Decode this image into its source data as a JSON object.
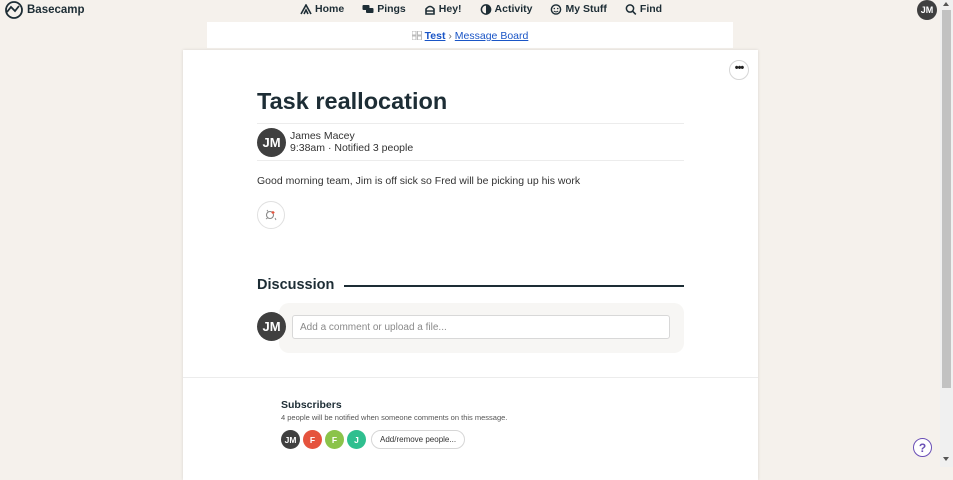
{
  "nav": {
    "brand": "Basecamp",
    "items": [
      {
        "label": "Home",
        "icon": "home-icon"
      },
      {
        "label": "Pings",
        "icon": "pings-icon"
      },
      {
        "label": "Hey!",
        "icon": "hey-icon"
      },
      {
        "label": "Activity",
        "icon": "activity-icon"
      },
      {
        "label": "My Stuff",
        "icon": "my-stuff-icon"
      },
      {
        "label": "Find",
        "icon": "search-icon"
      }
    ],
    "user_initials": "JM"
  },
  "breadcrumb": {
    "project": "Test",
    "separator": "›",
    "section": "Message Board"
  },
  "message": {
    "title": "Task reallocation",
    "author": "James Macey",
    "author_initials": "JM",
    "time": "9:38am",
    "meta_separator": "·",
    "notified": "Notified 3 people",
    "body": "Good morning team, Jim is off sick so Fred will be picking up his work",
    "more_label": "•••"
  },
  "discussion": {
    "title": "Discussion",
    "user_initials": "JM",
    "placeholder": "Add a comment or upload a file..."
  },
  "subscribers": {
    "title": "Subscribers",
    "note": "4 people will be notified when someone comments on this message.",
    "people": [
      {
        "initials": "JM",
        "color": "#3f3f3f"
      },
      {
        "initials": "F",
        "color": "#e5533d"
      },
      {
        "initials": "F",
        "color": "#8bc34a"
      },
      {
        "initials": "J",
        "color": "#2fbf8f"
      }
    ],
    "button": "Add/remove people..."
  },
  "help": {
    "label": "?"
  },
  "colors": {
    "background": "#f5f1ec",
    "link": "#1a55c6",
    "help_accent": "#6a4fb6"
  }
}
